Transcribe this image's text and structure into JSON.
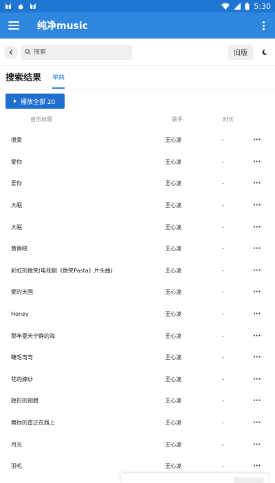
{
  "status_bar": {
    "left_icons": [
      "bug-icon",
      "flame-icon",
      "bug-icon"
    ],
    "time": "5:30"
  },
  "app_bar": {
    "title": "纯净music"
  },
  "search": {
    "placeholder": "搜索",
    "old_version_label": "旧版"
  },
  "section": {
    "title": "搜索结果",
    "tab_label": "单曲"
  },
  "play_all": {
    "label": "播放全部 20"
  },
  "table": {
    "headers": {
      "title": "音乐标题",
      "artist": "歌手",
      "duration": "时长"
    },
    "rows": [
      {
        "title": "很爱",
        "artist": "王心凌",
        "duration": "-"
      },
      {
        "title": "爱你",
        "artist": "王心凌",
        "duration": "-"
      },
      {
        "title": "爱你",
        "artist": "王心凌",
        "duration": "-"
      },
      {
        "title": "大眠",
        "artist": "王心凌",
        "duration": "-"
      },
      {
        "title": "大眠",
        "artist": "王心凌",
        "duration": "-"
      },
      {
        "title": "黄昏晓",
        "artist": "王心凌",
        "duration": "-"
      },
      {
        "title": "彩虹的微笑(电视剧《微笑Pasta》片头曲)",
        "artist": "王心凌",
        "duration": "-"
      },
      {
        "title": "爱的天国",
        "artist": "王心凌",
        "duration": "-"
      },
      {
        "title": "Honey",
        "artist": "王心凌",
        "duration": "-"
      },
      {
        "title": "那年夏天宁静的海",
        "artist": "王心凌",
        "duration": "-"
      },
      {
        "title": "睫毛弯弯",
        "artist": "王心凌",
        "duration": "-"
      },
      {
        "title": "花的嫁纱",
        "artist": "王心凌",
        "duration": "-"
      },
      {
        "title": "隐形的翅膀",
        "artist": "王心凌",
        "duration": "-"
      },
      {
        "title": "舞你的雷正在路上",
        "artist": "王心凌",
        "duration": "-"
      },
      {
        "title": "月光",
        "artist": "王心凌",
        "duration": "-"
      },
      {
        "title": "羽毛",
        "artist": "王心凌",
        "duration": "-"
      }
    ],
    "more_label": "···"
  },
  "colors": {
    "primary": "#2f86de",
    "status_bar": "#1e76d2",
    "button": "#1f6fd0"
  }
}
